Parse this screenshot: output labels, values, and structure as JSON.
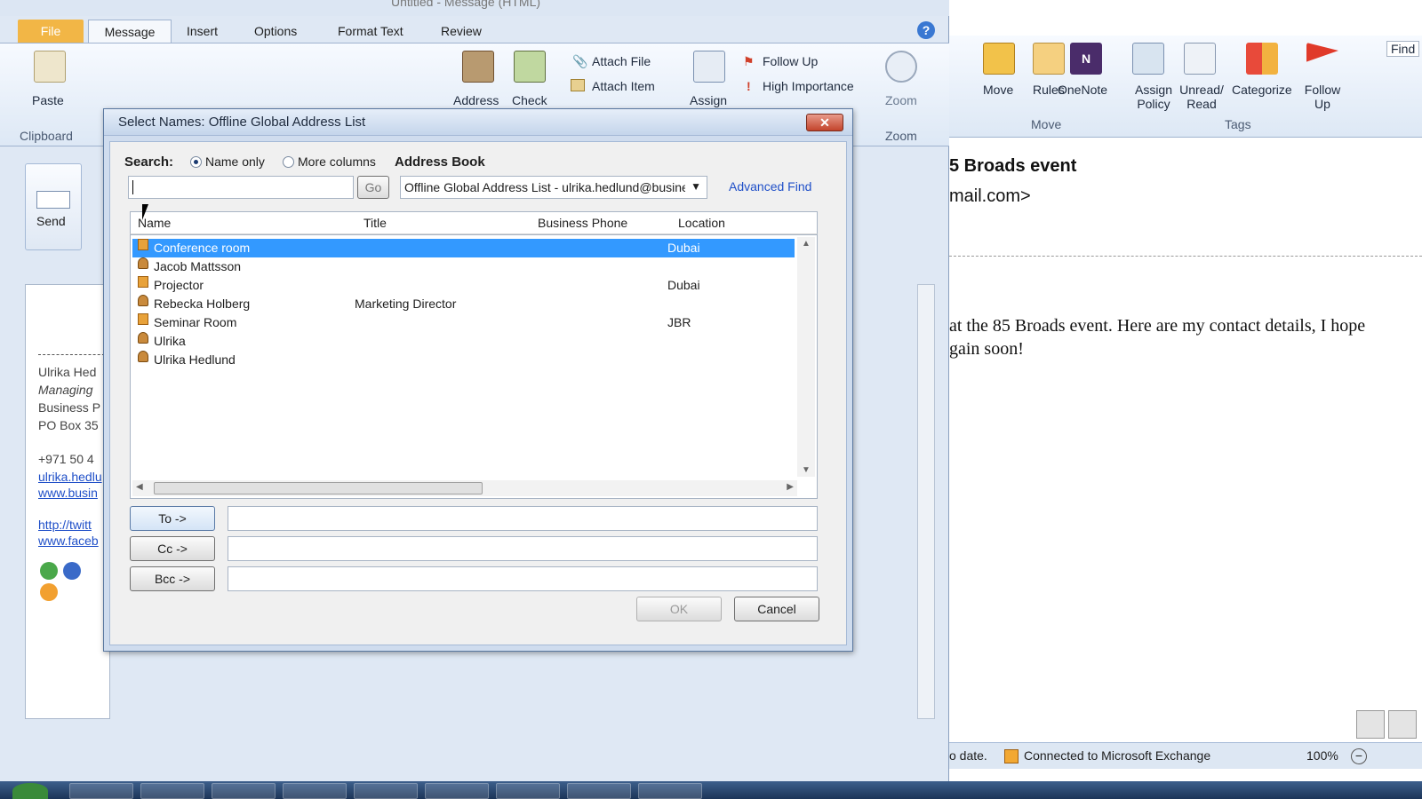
{
  "outlook": {
    "title": "Untitled - Message (HTML)",
    "tabs": [
      "File",
      "Message",
      "Insert",
      "Options",
      "Format Text",
      "Review"
    ],
    "ribbon": {
      "paste": "Paste",
      "clipboard": "Clipboard",
      "address": "Address",
      "check": "Check",
      "attach_file": "Attach File",
      "attach_item": "Attach Item",
      "assign": "Assign",
      "follow_up": "Follow Up",
      "high_importance": "High Importance",
      "zoom": "Zoom",
      "zoom_group": "Zoom"
    },
    "send": "Send",
    "signature": {
      "name": "Ulrika Hed",
      "title": "Managing",
      "line3": "Business P",
      "line4": "PO Box 35",
      "phone": "+971 50 4",
      "email": "ulrika.hedlu",
      "web": "www.busin",
      "twitter": "http://twitt",
      "facebook": "www.faceb"
    }
  },
  "mainwindow": {
    "ribbon": {
      "move": "Move",
      "rules": "Rules",
      "onenote": "OneNote",
      "move_group": "Move",
      "assign_policy": "Assign Policy",
      "unread_read": "Unread/ Read",
      "categorize": "Categorize",
      "follow_up": "Follow Up",
      "tags_group": "Tags",
      "find": "Find"
    },
    "reading": {
      "subject": "5 Broads event",
      "from": "mail.com>",
      "body1": "at the 85 Broads event. Here are my contact details, I hope",
      "body2": "gain soon!"
    },
    "status": {
      "left": "o date.",
      "connection": "Connected to Microsoft Exchange",
      "zoom": "100%"
    }
  },
  "dialog": {
    "title": "Select Names: Offline Global Address List",
    "close": "✕",
    "search_label": "Search:",
    "name_only": "Name only",
    "more_columns": "More columns",
    "address_book_label": "Address Book",
    "go": "Go",
    "address_book_value": "Offline Global Address List - ulrika.hedlund@busine",
    "advanced_find": "Advanced Find",
    "columns": [
      "Name",
      "Title",
      "Business Phone",
      "Location"
    ],
    "rows": [
      {
        "name": "Conference room",
        "title": "",
        "phone": "",
        "location": "Dubai",
        "type": "room"
      },
      {
        "name": "Jacob Mattsson",
        "title": "",
        "phone": "",
        "location": "",
        "type": "user"
      },
      {
        "name": "Projector",
        "title": "",
        "phone": "",
        "location": "Dubai",
        "type": "room"
      },
      {
        "name": "Rebecka Holberg",
        "title": "Marketing Director",
        "phone": "",
        "location": "",
        "type": "user"
      },
      {
        "name": "Seminar Room",
        "title": "",
        "phone": "",
        "location": "JBR",
        "type": "room"
      },
      {
        "name": "Ulrika",
        "title": "",
        "phone": "",
        "location": "",
        "type": "user"
      },
      {
        "name": "Ulrika Hedlund",
        "title": "",
        "phone": "",
        "location": "",
        "type": "user"
      }
    ],
    "to": "To ->",
    "cc": "Cc ->",
    "bcc": "Bcc ->",
    "ok": "OK",
    "cancel": "Cancel"
  }
}
